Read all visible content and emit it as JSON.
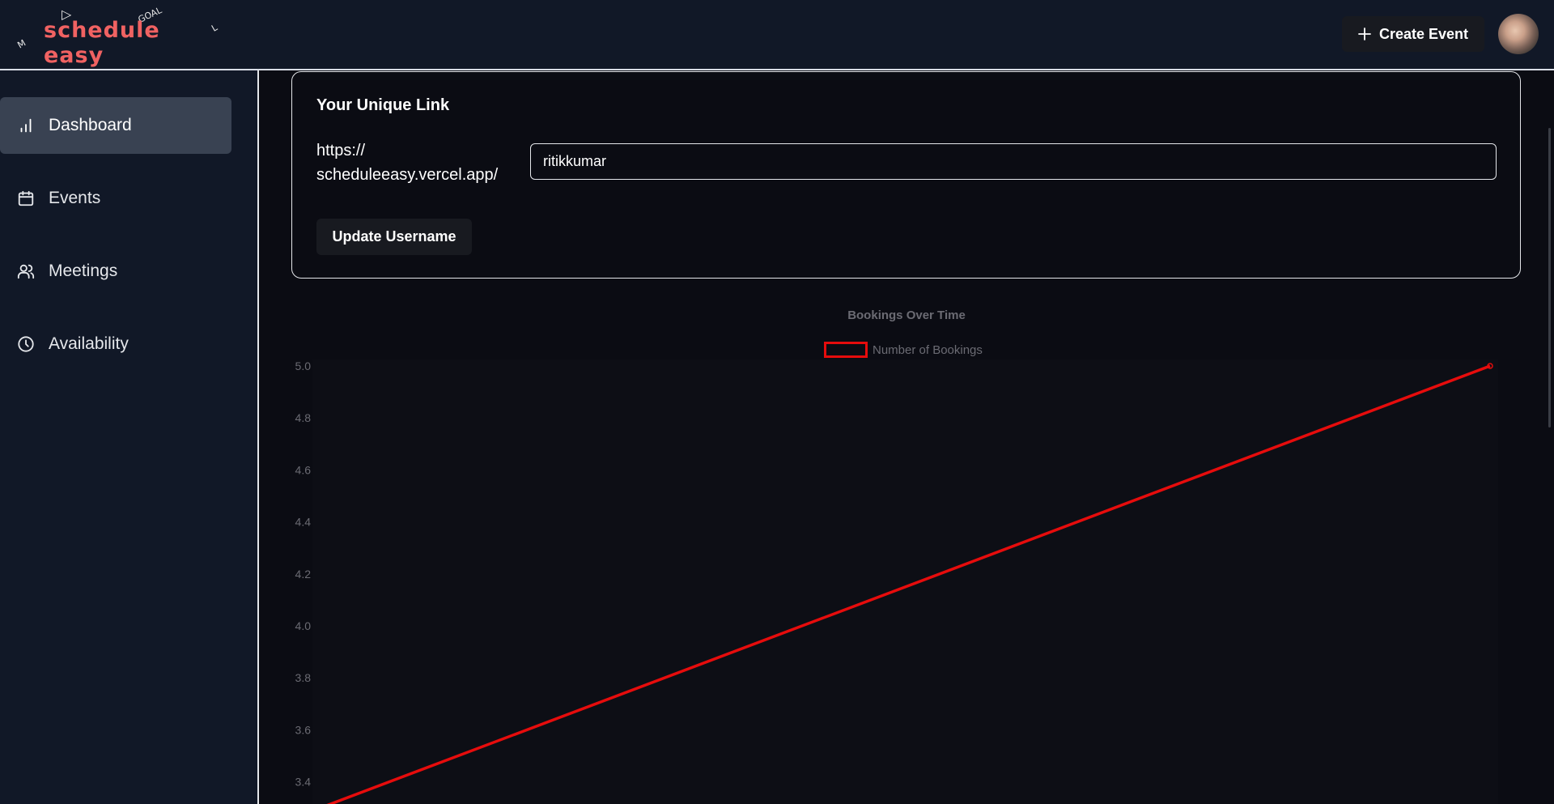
{
  "header": {
    "logo": {
      "text": "schedule easy",
      "deco_top": "GOAL",
      "deco_left": "M",
      "deco_right": "L"
    },
    "create_event_label": "Create Event"
  },
  "sidebar": {
    "items": [
      {
        "label": "Dashboard",
        "icon": "bar-chart-icon",
        "active": true
      },
      {
        "label": "Events",
        "icon": "calendar-icon",
        "active": false
      },
      {
        "label": "Meetings",
        "icon": "users-icon",
        "active": false
      },
      {
        "label": "Availability",
        "icon": "clock-icon",
        "active": false
      }
    ]
  },
  "link_card": {
    "title": "Your Unique Link",
    "url_prefix": "https://\nscheduleeasy.vercel.app/",
    "username_value": "ritikkumar",
    "update_button_label": "Update Username"
  },
  "colors": {
    "background": "#0b0c13",
    "panel": "#111827",
    "active_nav": "#394252",
    "line": "#e60c0c",
    "logo": "#f06262"
  },
  "chart_data": {
    "type": "line",
    "title": "Bookings Over Time",
    "series": [
      {
        "name": "Number of Bookings",
        "x": [
          0,
          1
        ],
        "values": [
          3.3,
          5.0
        ]
      }
    ],
    "y_ticks": [
      "5.0",
      "4.8",
      "4.6",
      "4.4",
      "4.2",
      "4.0",
      "3.8",
      "3.6",
      "3.4"
    ],
    "ylim": [
      3.3,
      5.0
    ],
    "grid": false,
    "legend": "top-center"
  }
}
